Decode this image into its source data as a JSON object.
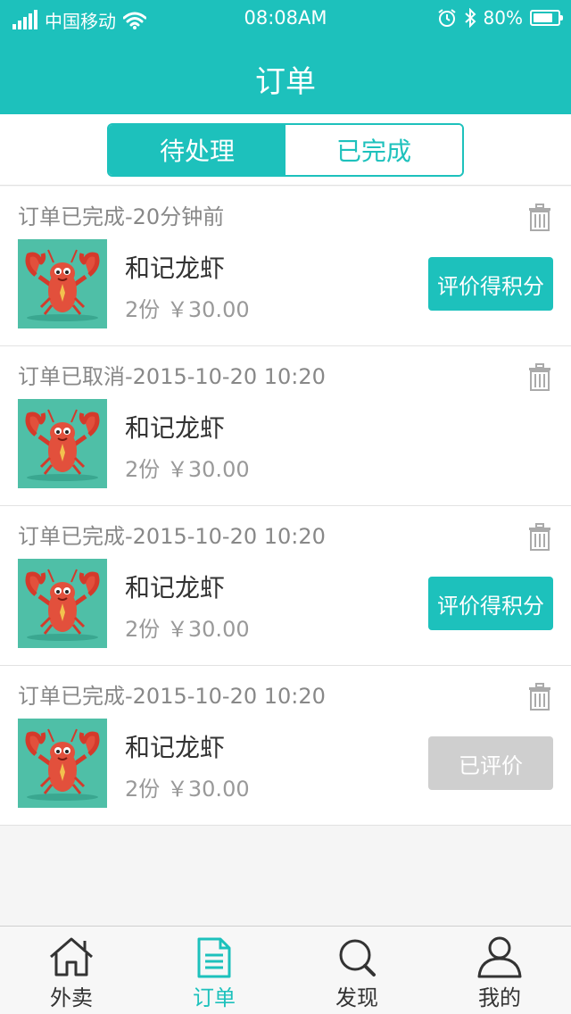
{
  "status_bar": {
    "carrier": "中国移动",
    "time": "08:08AM",
    "battery": "80%",
    "battery_level": 0.8
  },
  "header": {
    "title": "订单"
  },
  "segments": [
    {
      "label": "待处理",
      "active": true
    },
    {
      "label": "已完成",
      "active": false
    }
  ],
  "orders": [
    {
      "status": "订单已完成-20分钟前",
      "name": "和记龙虾",
      "price": "2份 ￥30.00",
      "action": "评价得积分",
      "action_state": "primary"
    },
    {
      "status": "订单已取消-2015-10-20 10:20",
      "name": "和记龙虾",
      "price": "2份 ￥30.00",
      "action": "",
      "action_state": "none"
    },
    {
      "status": "订单已完成-2015-10-20 10:20",
      "name": "和记龙虾",
      "price": "2份 ￥30.00",
      "action": "评价得积分",
      "action_state": "primary"
    },
    {
      "status": "订单已完成-2015-10-20 10:20",
      "name": "和记龙虾",
      "price": "2份 ￥30.00",
      "action": "已评价",
      "action_state": "disabled"
    }
  ],
  "tabs": [
    {
      "label": "外卖",
      "icon": "home-icon"
    },
    {
      "label": "订单",
      "icon": "document-icon"
    },
    {
      "label": "发现",
      "icon": "search-icon"
    },
    {
      "label": "我的",
      "icon": "user-icon"
    }
  ],
  "colors": {
    "accent": "#1dc1bc",
    "disabled": "#cfcfcf"
  }
}
